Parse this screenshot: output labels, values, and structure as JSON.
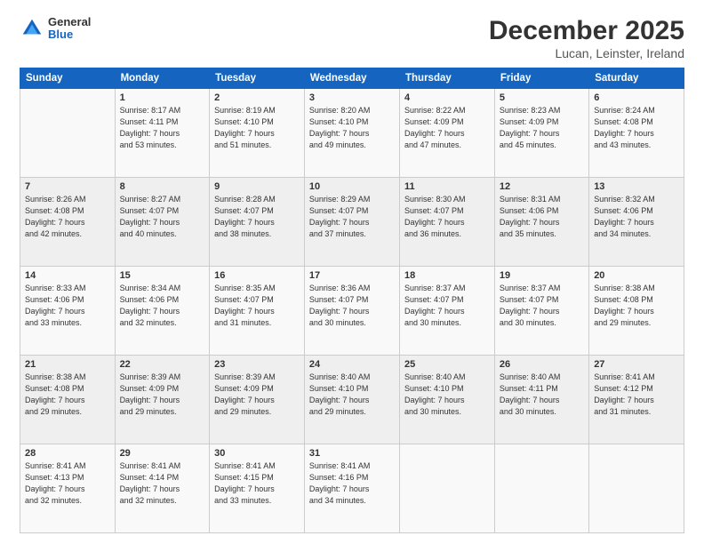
{
  "header": {
    "logo_general": "General",
    "logo_blue": "Blue",
    "title": "December 2025",
    "subtitle": "Lucan, Leinster, Ireland"
  },
  "calendar": {
    "days_of_week": [
      "Sunday",
      "Monday",
      "Tuesday",
      "Wednesday",
      "Thursday",
      "Friday",
      "Saturday"
    ],
    "weeks": [
      [
        {
          "day": "",
          "info": ""
        },
        {
          "day": "1",
          "info": "Sunrise: 8:17 AM\nSunset: 4:11 PM\nDaylight: 7 hours\nand 53 minutes."
        },
        {
          "day": "2",
          "info": "Sunrise: 8:19 AM\nSunset: 4:10 PM\nDaylight: 7 hours\nand 51 minutes."
        },
        {
          "day": "3",
          "info": "Sunrise: 8:20 AM\nSunset: 4:10 PM\nDaylight: 7 hours\nand 49 minutes."
        },
        {
          "day": "4",
          "info": "Sunrise: 8:22 AM\nSunset: 4:09 PM\nDaylight: 7 hours\nand 47 minutes."
        },
        {
          "day": "5",
          "info": "Sunrise: 8:23 AM\nSunset: 4:09 PM\nDaylight: 7 hours\nand 45 minutes."
        },
        {
          "day": "6",
          "info": "Sunrise: 8:24 AM\nSunset: 4:08 PM\nDaylight: 7 hours\nand 43 minutes."
        }
      ],
      [
        {
          "day": "7",
          "info": "Sunrise: 8:26 AM\nSunset: 4:08 PM\nDaylight: 7 hours\nand 42 minutes."
        },
        {
          "day": "8",
          "info": "Sunrise: 8:27 AM\nSunset: 4:07 PM\nDaylight: 7 hours\nand 40 minutes."
        },
        {
          "day": "9",
          "info": "Sunrise: 8:28 AM\nSunset: 4:07 PM\nDaylight: 7 hours\nand 38 minutes."
        },
        {
          "day": "10",
          "info": "Sunrise: 8:29 AM\nSunset: 4:07 PM\nDaylight: 7 hours\nand 37 minutes."
        },
        {
          "day": "11",
          "info": "Sunrise: 8:30 AM\nSunset: 4:07 PM\nDaylight: 7 hours\nand 36 minutes."
        },
        {
          "day": "12",
          "info": "Sunrise: 8:31 AM\nSunset: 4:06 PM\nDaylight: 7 hours\nand 35 minutes."
        },
        {
          "day": "13",
          "info": "Sunrise: 8:32 AM\nSunset: 4:06 PM\nDaylight: 7 hours\nand 34 minutes."
        }
      ],
      [
        {
          "day": "14",
          "info": "Sunrise: 8:33 AM\nSunset: 4:06 PM\nDaylight: 7 hours\nand 33 minutes."
        },
        {
          "day": "15",
          "info": "Sunrise: 8:34 AM\nSunset: 4:06 PM\nDaylight: 7 hours\nand 32 minutes."
        },
        {
          "day": "16",
          "info": "Sunrise: 8:35 AM\nSunset: 4:07 PM\nDaylight: 7 hours\nand 31 minutes."
        },
        {
          "day": "17",
          "info": "Sunrise: 8:36 AM\nSunset: 4:07 PM\nDaylight: 7 hours\nand 30 minutes."
        },
        {
          "day": "18",
          "info": "Sunrise: 8:37 AM\nSunset: 4:07 PM\nDaylight: 7 hours\nand 30 minutes."
        },
        {
          "day": "19",
          "info": "Sunrise: 8:37 AM\nSunset: 4:07 PM\nDaylight: 7 hours\nand 30 minutes."
        },
        {
          "day": "20",
          "info": "Sunrise: 8:38 AM\nSunset: 4:08 PM\nDaylight: 7 hours\nand 29 minutes."
        }
      ],
      [
        {
          "day": "21",
          "info": "Sunrise: 8:38 AM\nSunset: 4:08 PM\nDaylight: 7 hours\nand 29 minutes."
        },
        {
          "day": "22",
          "info": "Sunrise: 8:39 AM\nSunset: 4:09 PM\nDaylight: 7 hours\nand 29 minutes."
        },
        {
          "day": "23",
          "info": "Sunrise: 8:39 AM\nSunset: 4:09 PM\nDaylight: 7 hours\nand 29 minutes."
        },
        {
          "day": "24",
          "info": "Sunrise: 8:40 AM\nSunset: 4:10 PM\nDaylight: 7 hours\nand 29 minutes."
        },
        {
          "day": "25",
          "info": "Sunrise: 8:40 AM\nSunset: 4:10 PM\nDaylight: 7 hours\nand 30 minutes."
        },
        {
          "day": "26",
          "info": "Sunrise: 8:40 AM\nSunset: 4:11 PM\nDaylight: 7 hours\nand 30 minutes."
        },
        {
          "day": "27",
          "info": "Sunrise: 8:41 AM\nSunset: 4:12 PM\nDaylight: 7 hours\nand 31 minutes."
        }
      ],
      [
        {
          "day": "28",
          "info": "Sunrise: 8:41 AM\nSunset: 4:13 PM\nDaylight: 7 hours\nand 32 minutes."
        },
        {
          "day": "29",
          "info": "Sunrise: 8:41 AM\nSunset: 4:14 PM\nDaylight: 7 hours\nand 32 minutes."
        },
        {
          "day": "30",
          "info": "Sunrise: 8:41 AM\nSunset: 4:15 PM\nDaylight: 7 hours\nand 33 minutes."
        },
        {
          "day": "31",
          "info": "Sunrise: 8:41 AM\nSunset: 4:16 PM\nDaylight: 7 hours\nand 34 minutes."
        },
        {
          "day": "",
          "info": ""
        },
        {
          "day": "",
          "info": ""
        },
        {
          "day": "",
          "info": ""
        }
      ]
    ]
  }
}
